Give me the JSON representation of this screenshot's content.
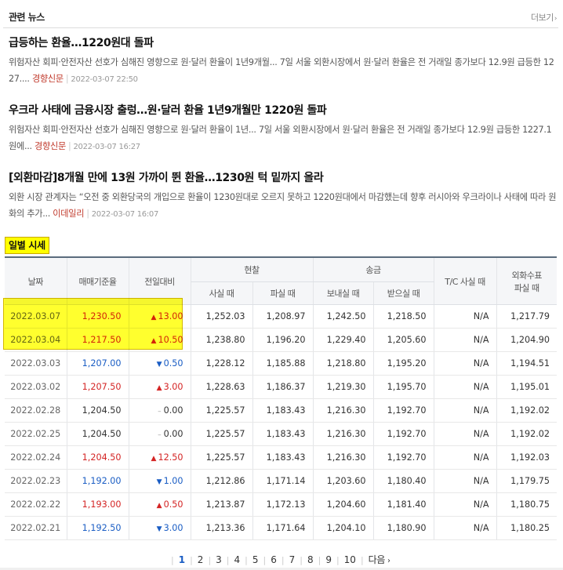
{
  "news": {
    "title": "관련 뉴스",
    "more_label": "더보기",
    "items": [
      {
        "headline": "급등하는 환율…1220원대 돌파",
        "summary": "위험자산 회피·안전자산 선호가 심해진 영향으로 원·달러 환율이 1년9개월... 7일 서울 외환시장에서 원·달러 환율은 전 거래일 종가보다 12.9원 급등한 1227....",
        "source": "경향신문",
        "date": "2022-03-07 22:50"
      },
      {
        "headline": "우크라 사태에 금융시장 출렁…원·달러 환율 1년9개월만 1220원 돌파",
        "summary": "위험자산 회피·안전자산 선호가 심해진 영향으로 원·달러 환율이 1년... 7일 서울 외환시장에서 원·달러 환율은 전 거래일 종가보다 12.9원 급등한 1227.1원에...",
        "source": "경향신문",
        "date": "2022-03-07 16:27"
      },
      {
        "headline": "[외환마감]8개월 만에 13원 가까이 뛴 환율…1230원 턱 밑까지 올라",
        "summary": "외환 시장 관계자는 “오전 중 외환당국의 개입으로 환율이 1230원대로 오르지 못하고 1220원대에서 마감했는데 향후 러시아와 우크라이나 사태에 따라 원화의 추가...",
        "source": "이데일리",
        "date": "2022-03-07 16:07"
      }
    ]
  },
  "daily": {
    "label": "일별 시세",
    "headers": {
      "date": "날짜",
      "base": "매매기준율",
      "change": "전일대비",
      "cash": "현찰",
      "cash_buy": "사실 때",
      "cash_sell": "파실 때",
      "transfer": "송금",
      "send": "보내실 때",
      "receive": "받으실 때",
      "tc": "T/C 사실 때",
      "check_line1": "외화수표",
      "check_line2": "파실 때"
    },
    "rows": [
      {
        "date": "2022.03.07",
        "base": "1,230.50",
        "dir": "up",
        "change": "13.00",
        "cash_buy": "1,252.03",
        "cash_sell": "1,208.97",
        "send": "1,242.50",
        "receive": "1,218.50",
        "tc": "N/A",
        "check": "1,217.79"
      },
      {
        "date": "2022.03.04",
        "base": "1,217.50",
        "dir": "up",
        "change": "10.50",
        "cash_buy": "1,238.80",
        "cash_sell": "1,196.20",
        "send": "1,229.40",
        "receive": "1,205.60",
        "tc": "N/A",
        "check": "1,204.90"
      },
      {
        "date": "2022.03.03",
        "base": "1,207.00",
        "dir": "down",
        "change": "0.50",
        "cash_buy": "1,228.12",
        "cash_sell": "1,185.88",
        "send": "1,218.80",
        "receive": "1,195.20",
        "tc": "N/A",
        "check": "1,194.51"
      },
      {
        "date": "2022.03.02",
        "base": "1,207.50",
        "dir": "up",
        "change": "3.00",
        "cash_buy": "1,228.63",
        "cash_sell": "1,186.37",
        "send": "1,219.30",
        "receive": "1,195.70",
        "tc": "N/A",
        "check": "1,195.01"
      },
      {
        "date": "2022.02.28",
        "base": "1,204.50",
        "dir": "flat",
        "change": "0.00",
        "cash_buy": "1,225.57",
        "cash_sell": "1,183.43",
        "send": "1,216.30",
        "receive": "1,192.70",
        "tc": "N/A",
        "check": "1,192.02"
      },
      {
        "date": "2022.02.25",
        "base": "1,204.50",
        "dir": "flat",
        "change": "0.00",
        "cash_buy": "1,225.57",
        "cash_sell": "1,183.43",
        "send": "1,216.30",
        "receive": "1,192.70",
        "tc": "N/A",
        "check": "1,192.02"
      },
      {
        "date": "2022.02.24",
        "base": "1,204.50",
        "dir": "up",
        "change": "12.50",
        "cash_buy": "1,225.57",
        "cash_sell": "1,183.43",
        "send": "1,216.30",
        "receive": "1,192.70",
        "tc": "N/A",
        "check": "1,192.03"
      },
      {
        "date": "2022.02.23",
        "base": "1,192.00",
        "dir": "down",
        "change": "1.00",
        "cash_buy": "1,212.86",
        "cash_sell": "1,171.14",
        "send": "1,203.60",
        "receive": "1,180.40",
        "tc": "N/A",
        "check": "1,179.75"
      },
      {
        "date": "2022.02.22",
        "base": "1,193.00",
        "dir": "up",
        "change": "0.50",
        "cash_buy": "1,213.87",
        "cash_sell": "1,172.13",
        "send": "1,204.60",
        "receive": "1,181.40",
        "tc": "N/A",
        "check": "1,180.75"
      },
      {
        "date": "2022.02.21",
        "base": "1,192.50",
        "dir": "down",
        "change": "3.00",
        "cash_buy": "1,213.36",
        "cash_sell": "1,171.64",
        "send": "1,204.10",
        "receive": "1,180.90",
        "tc": "N/A",
        "check": "1,180.25"
      }
    ]
  },
  "pager": {
    "pages": [
      "1",
      "2",
      "3",
      "4",
      "5",
      "6",
      "7",
      "8",
      "9",
      "10"
    ],
    "current": "1",
    "next_label": "다음"
  },
  "colors": {
    "up": "#d42424",
    "down": "#1a5dc4",
    "highlight": "#ffff00"
  }
}
